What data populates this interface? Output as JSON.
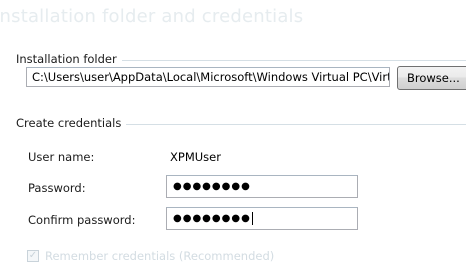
{
  "page_title": "Installation folder and credentials",
  "installation_folder": {
    "group_label": "Installation folder",
    "path_value": "C:\\Users\\user\\AppData\\Local\\Microsoft\\Windows Virtual PC\\Virtual M",
    "browse_label": "Browse..."
  },
  "credentials": {
    "group_label": "Create credentials",
    "username_label": "User name:",
    "username_value": "XPMUser",
    "password_label": "Password:",
    "password_value": "●●●●●●●●",
    "confirm_label": "Confirm password:",
    "confirm_value": "●●●●●●●●",
    "remember_label": "Remember credentials (Recommended)",
    "remember_checked": true
  }
}
